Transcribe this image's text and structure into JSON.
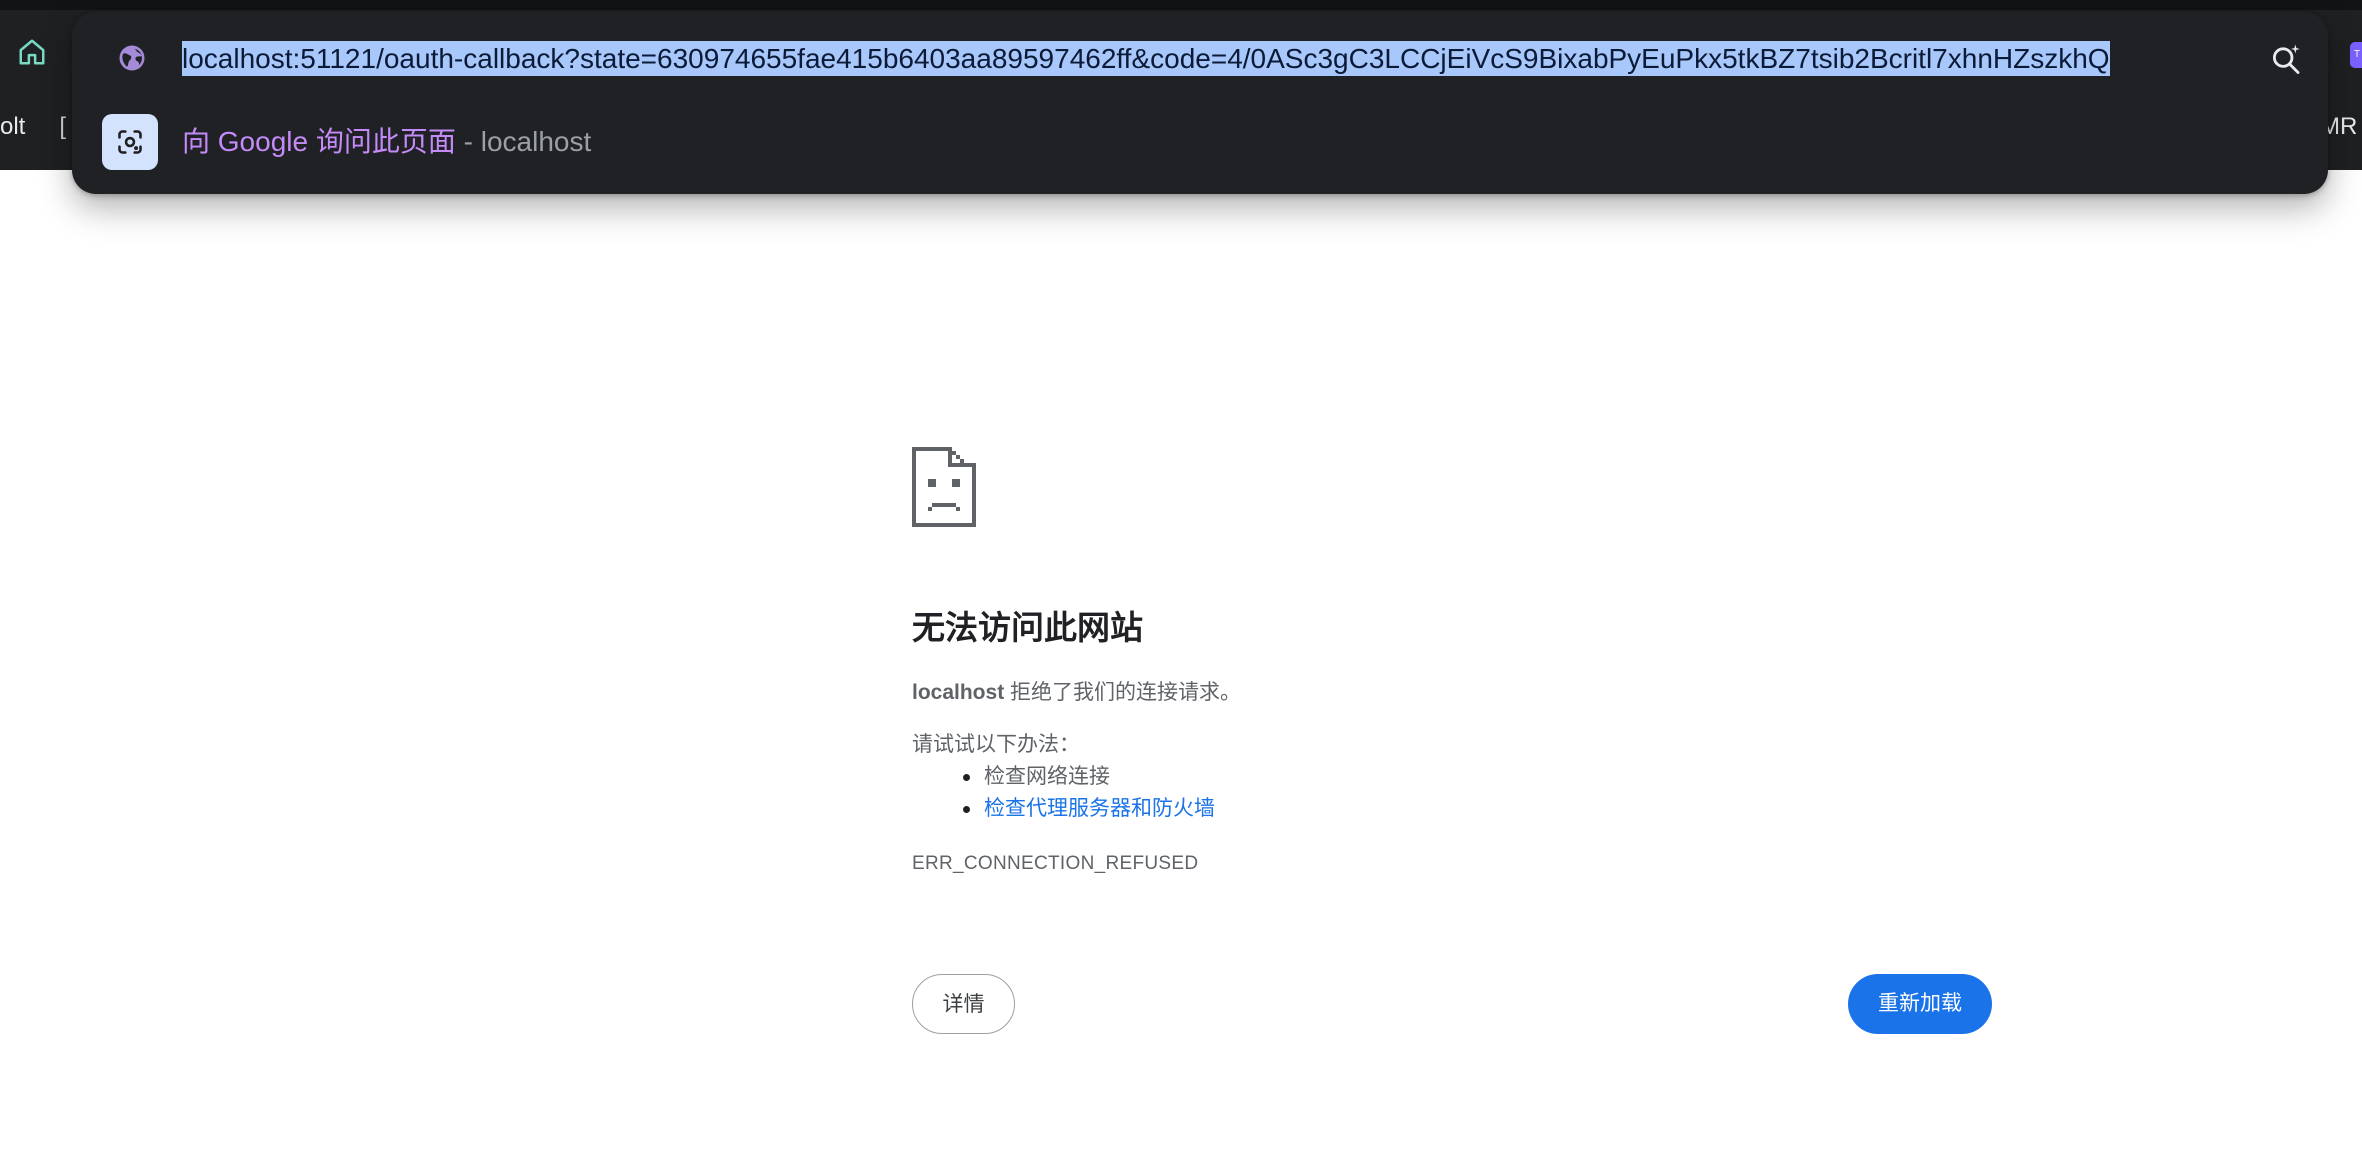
{
  "browser": {
    "bookmarks_left_fragment": "olt",
    "bookmarks_left_glyph": "[",
    "bookmarks_right_fragment": "MR",
    "extension_chip_label": "T"
  },
  "omnibox": {
    "url": "localhost:51121/oauth-callback?state=630974655fae415b6403aa89597462ff&code=4/0ASc3gC3LCCjEiVcS9BixabPyEuPkx5tkBZ7tsib2Bcritl7xhnHZszkhQ",
    "url_selected": true,
    "suggestion": {
      "main": "向 Google 询问此页面",
      "separator": " - ",
      "sub": "localhost",
      "icon": "google-lens-icon"
    }
  },
  "error": {
    "title": "无法访问此网站",
    "summary_host": "localhost",
    "summary_rest": " 拒绝了我们的连接请求。",
    "suggestions_heading": "请试试以下办法：",
    "suggestions": [
      {
        "text": "检查网络连接",
        "link": false
      },
      {
        "text": "检查代理服务器和防火墙",
        "link": true
      }
    ],
    "code": "ERR_CONNECTION_REFUSED",
    "details_button": "详情",
    "reload_button": "重新加载"
  },
  "colors": {
    "chrome_bg": "#1f2022",
    "omnibox_bg": "#202124",
    "selection": "#a8c7fa",
    "suggestion_accent": "#c58af9",
    "home_icon": "#79d9c5",
    "link": "#1a73e8",
    "primary_button": "#1a73e8"
  }
}
